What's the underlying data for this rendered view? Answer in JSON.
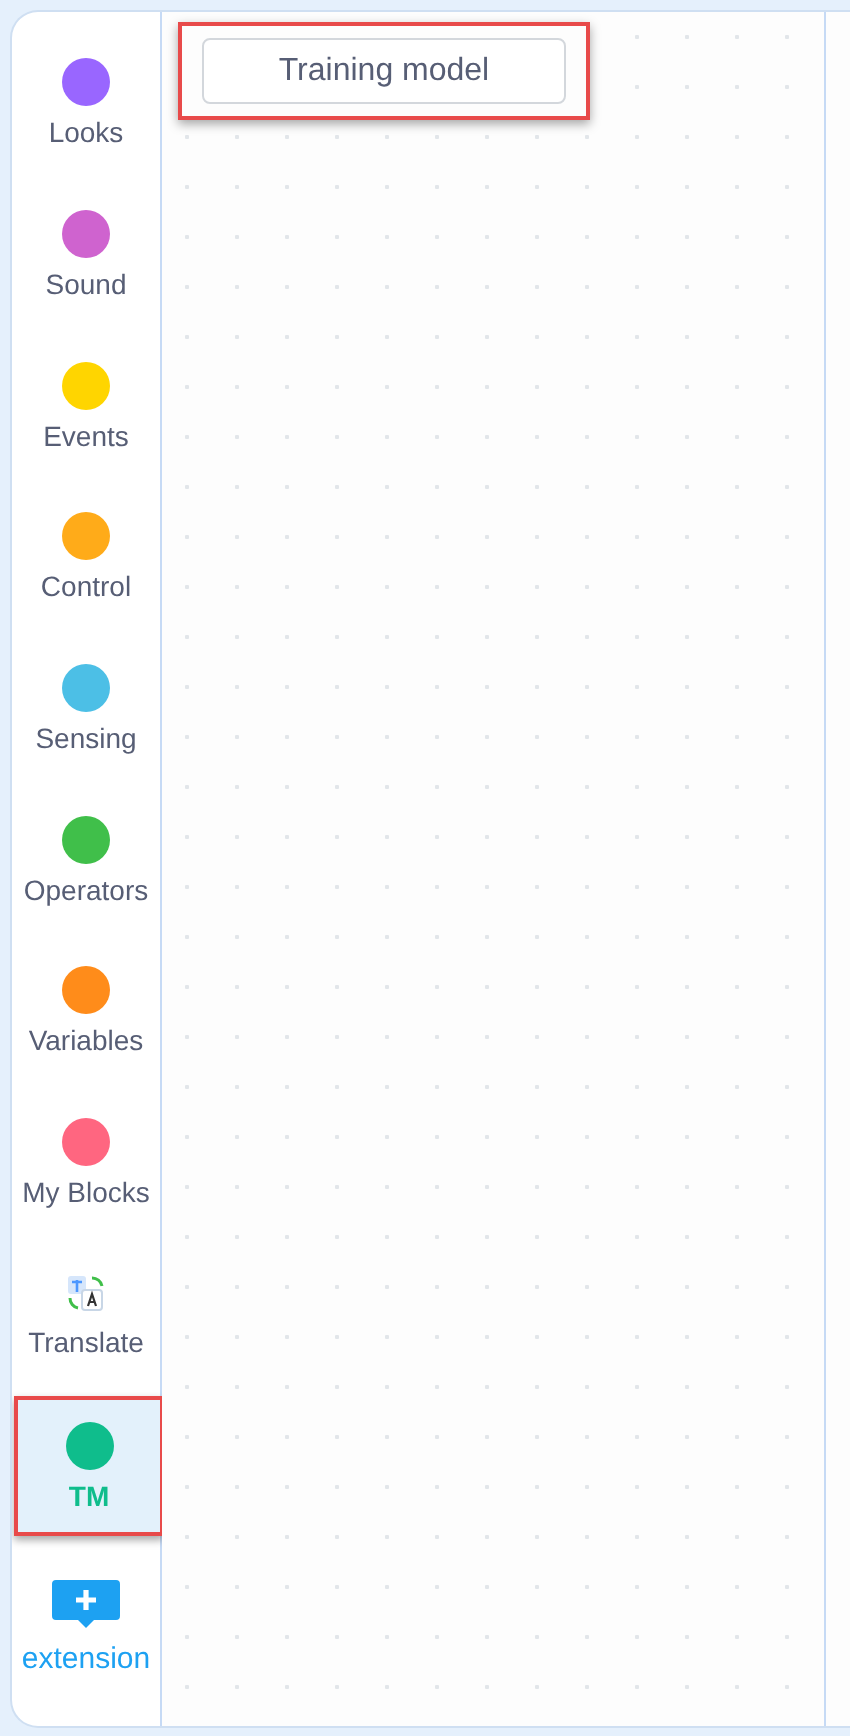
{
  "categories": [
    {
      "kind": "dot",
      "label": "Looks",
      "color": "#9966ff",
      "selected": false
    },
    {
      "kind": "dot",
      "label": "Sound",
      "color": "#cf63cf",
      "selected": false
    },
    {
      "kind": "dot",
      "label": "Events",
      "color": "#ffd500",
      "selected": false
    },
    {
      "kind": "dot",
      "label": "Control",
      "color": "#ffab19",
      "selected": false
    },
    {
      "kind": "dot",
      "label": "Sensing",
      "color": "#4cbfe6",
      "selected": false
    },
    {
      "kind": "dot",
      "label": "Operators",
      "color": "#40bf4a",
      "selected": false
    },
    {
      "kind": "dot",
      "label": "Variables",
      "color": "#ff8c1a",
      "selected": false
    },
    {
      "kind": "dot",
      "label": "My Blocks",
      "color": "#ff6680",
      "selected": false
    },
    {
      "kind": "translate",
      "label": "Translate",
      "selected": false
    },
    {
      "kind": "dot",
      "label": "TM",
      "color": "#0fbd8c",
      "selected": true
    }
  ],
  "extension": {
    "label": "extension"
  },
  "workspace": {
    "button": {
      "label": "Training model",
      "highlighted": true
    }
  }
}
